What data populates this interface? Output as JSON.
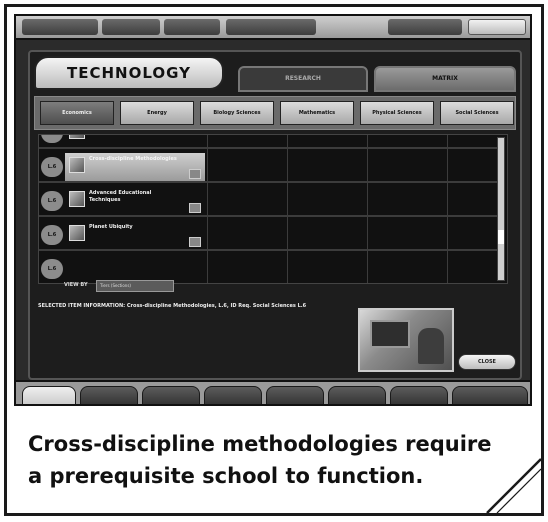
{
  "window": {
    "title": "TECHNOLOGY",
    "tabs": [
      {
        "label": "RESEARCH"
      },
      {
        "label": "MATRIX"
      }
    ]
  },
  "categories": [
    {
      "label": "Economics",
      "active": true
    },
    {
      "label": "Energy"
    },
    {
      "label": "Biology Sciences"
    },
    {
      "label": "Mathematics"
    },
    {
      "label": "Physical Sciences"
    },
    {
      "label": "Social Sciences"
    }
  ],
  "list": {
    "rows": [
      {
        "num": "L.6",
        "name": "",
        "selected": false
      },
      {
        "num": "L.6",
        "name": "Cross-discipline Methodologies",
        "selected": true
      },
      {
        "num": "L.6",
        "name": "Advanced Educational Techniques",
        "selected": false
      },
      {
        "num": "L.6",
        "name": "Planet Ubiquity",
        "selected": false
      },
      {
        "num": "L.6",
        "name": "",
        "selected": false
      }
    ],
    "view_by_label": "VIEW BY",
    "view_by_value": "Tiers (Sections)"
  },
  "info": {
    "title": "SELECTED ITEM INFORMATION: Cross-discipline Methodologies, L.6, ID Req. Social Sciences L.6",
    "body": "",
    "close_label": "CLOSE"
  },
  "caption": {
    "text": "Cross-discipline methodologies require a prerequisite school to function."
  },
  "colors": {
    "panel": "#1d1d1d",
    "chrome_light": "#cfcfcf",
    "caption_text": "#111111"
  }
}
